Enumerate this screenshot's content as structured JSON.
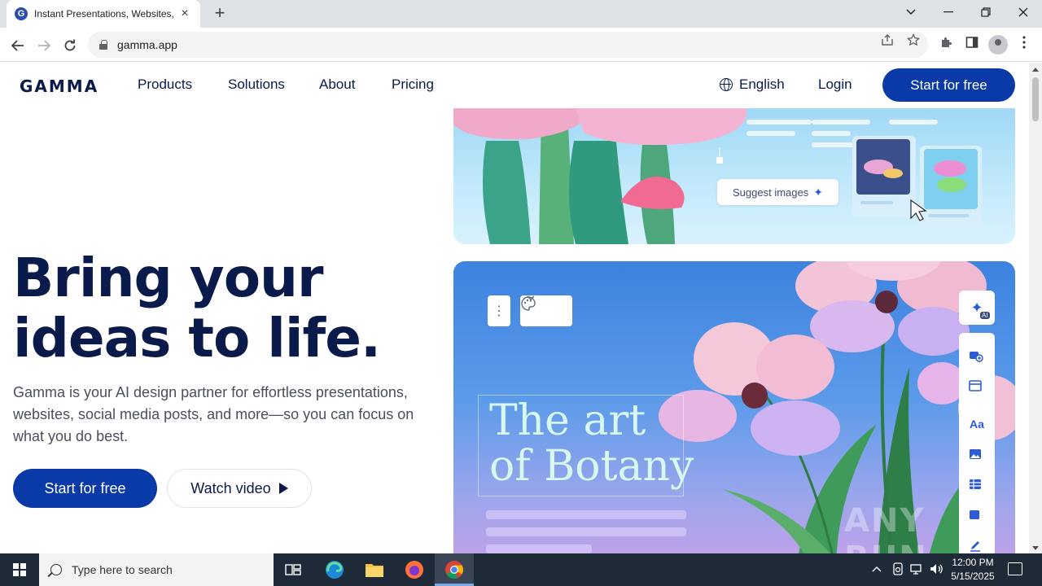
{
  "browser": {
    "tab_title": "Instant Presentations, Websites,",
    "tab_favicon_letter": "G",
    "url": "gamma.app"
  },
  "site": {
    "logo": "GAMMA",
    "nav": [
      "Products",
      "Solutions",
      "About",
      "Pricing"
    ],
    "language": "English",
    "login": "Login",
    "cta_top": "Start for free"
  },
  "hero": {
    "title_line1": "Bring your",
    "title_line2": "ideas to life.",
    "subtitle": "Gamma is your AI design partner for effortless presentations, websites, social media posts, and more—so you can focus on what you do best.",
    "cta_primary": "Start for free",
    "cta_secondary": "Watch video"
  },
  "showcase": {
    "suggest_label": "Suggest images",
    "botany_line1": "The art",
    "botany_line2": "of Botany",
    "ai_tag": "AI",
    "watermark": "ANY RUN"
  },
  "taskbar": {
    "search_placeholder": "Type here to search",
    "time": "12:00 PM",
    "date": "5/15/2025"
  },
  "colors": {
    "brand_navy": "#0a1a4a",
    "brand_blue": "#0a3aa8"
  }
}
